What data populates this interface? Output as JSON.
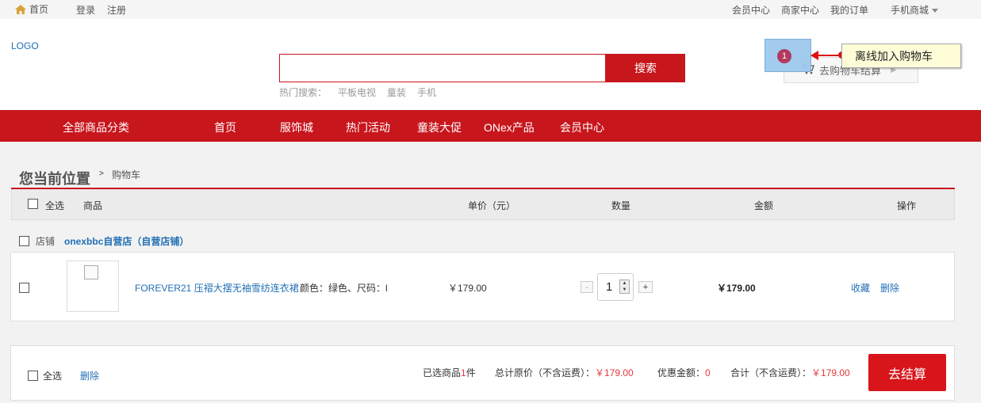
{
  "topbar": {
    "home": "首页",
    "login": "登录",
    "register": "注册",
    "member_center": "会员中心",
    "merchant_center": "商家中心",
    "my_orders": "我的订单",
    "mobile_mall": "手机商城"
  },
  "header": {
    "logo": "LOGO",
    "search_value": "",
    "search_button": "搜索",
    "hot_label": "热门搜索：",
    "hot_terms": [
      "平板电视",
      "童装",
      "手机"
    ],
    "cart_button": "去购物车结算",
    "badge": "1",
    "tooltip": "离线加入购物车"
  },
  "nav": {
    "all_categories": "全部商品分类",
    "items": [
      "首页",
      "服饰城",
      "热门活动",
      "童装大促",
      "ONex产品",
      "会员中心"
    ]
  },
  "breadcrumb": {
    "title": "您当前位置",
    "sep": ">",
    "current": "购物车"
  },
  "table": {
    "select_all": "全选",
    "col_product": "商品",
    "col_unit_price": "单价（元）",
    "col_qty": "数量",
    "col_amount": "金额",
    "col_action": "操作"
  },
  "shop": {
    "label": "店铺",
    "name": "onexbbc自营店（自营店铺）"
  },
  "item": {
    "name": "FOREVER21 压褶大摆无袖雪纺连衣裙",
    "spec": "颜色：绿色、尺码：l",
    "unit_price": "￥179.00",
    "qty": "1",
    "qty_minus": "-",
    "qty_plus": "+",
    "amount": "￥179.00",
    "favorite": "收藏",
    "delete": "删除"
  },
  "footer": {
    "select_all": "全选",
    "delete": "删除",
    "selected_prefix": "已选商品",
    "selected_count": "1",
    "selected_suffix": "件",
    "total_label": "总计原价（不含运费）：",
    "total_value": "￥179.00",
    "discount_label": "优惠金额：",
    "discount_value": "0",
    "sum_label": "合计（不含运费）：",
    "sum_value": "￥179.00",
    "checkout": "去结算"
  },
  "colors": {
    "brand_red": "#c8161d",
    "link_blue": "#1f6fb5",
    "price_red": "#e4393c"
  }
}
